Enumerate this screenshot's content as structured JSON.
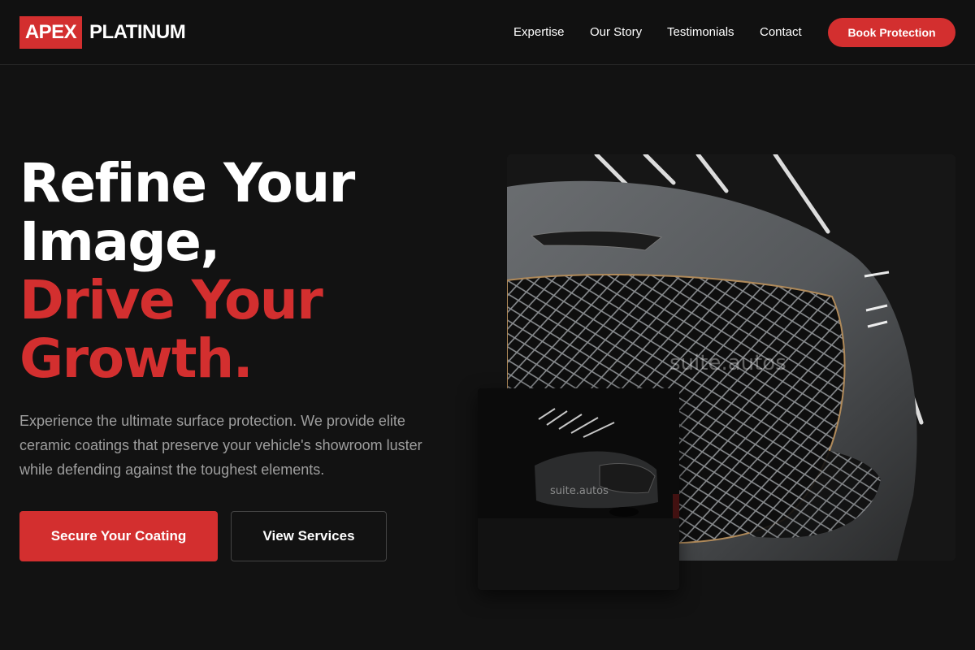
{
  "brand": {
    "logo_box": "APEX",
    "logo_text": "PLATINUM",
    "accent_color": "#d32f2f"
  },
  "nav": {
    "items": [
      "Expertise",
      "Our Story",
      "Testimonials",
      "Contact"
    ],
    "cta": "Book Protection"
  },
  "hero": {
    "title_line1": "Refine Your",
    "title_line2": "Image,",
    "title_line3": "Drive Your",
    "title_line4": "Growth.",
    "description": "Experience the ultimate surface protection. We provide elite ceramic coatings that preserve your vehicle's showroom luster while defending against the toughest elements.",
    "primary_button": "Secure Your Coating",
    "secondary_button": "View Services"
  },
  "images": {
    "main_watermark": "suite.autos",
    "secondary_watermark": "suite.autos"
  }
}
